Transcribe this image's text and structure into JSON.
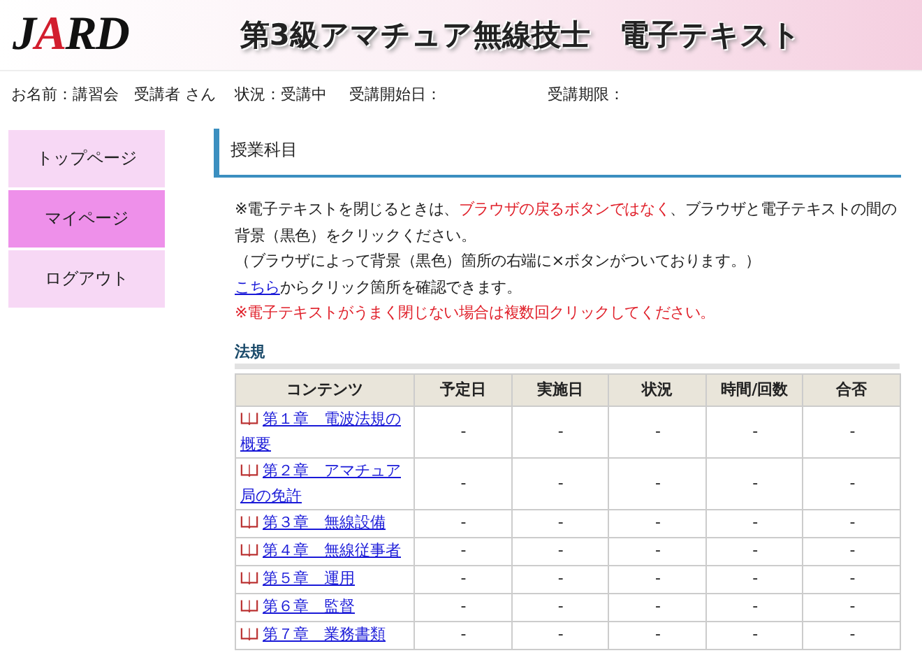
{
  "header": {
    "logo": [
      {
        "text": "J",
        "accent": false
      },
      {
        "text": "A",
        "accent": true
      },
      {
        "text": "RD",
        "accent": false
      }
    ],
    "title": "第3級アマチュア無線技士　電子テキスト"
  },
  "user_info": [
    "お名前：講習会　受講者 さん",
    "状況：受講中",
    "受講開始日：",
    "受講期限："
  ],
  "sidebar": {
    "items": [
      {
        "label": "トップページ",
        "selected": false
      },
      {
        "label": "マイページ",
        "selected": true
      },
      {
        "label": "ログアウト",
        "selected": false
      }
    ]
  },
  "section_title": "授業科目",
  "notes": [
    {
      "parts": [
        {
          "kind": "text",
          "text": "※電子テキストを閉じるときは、"
        },
        {
          "kind": "red",
          "text": "ブラウザの戻るボタンではなく"
        },
        {
          "kind": "text",
          "text": "、ブラウザと電子テキストの間の背景（黒色）をクリックください。"
        }
      ]
    },
    {
      "parts": [
        {
          "kind": "text",
          "text": "（ブラウザによって背景（黒色）箇所の右端に×ボタンがついております。）"
        }
      ]
    },
    {
      "parts": [
        {
          "kind": "link",
          "text": "こちら"
        },
        {
          "kind": "text",
          "text": "からクリック箇所を確認できます。"
        }
      ]
    },
    {
      "parts": [
        {
          "kind": "red",
          "text": "※電子テキストがうまく閉じない場合は複数回クリックしてください。"
        }
      ]
    }
  ],
  "subject": "法規",
  "table": {
    "columns": [
      "コンテンツ",
      "予定日",
      "実施日",
      "状況",
      "時間/回数",
      "合否"
    ],
    "rows": [
      {
        "cells": [
          "第１章　電波法規の概要",
          "-",
          "-",
          "-",
          "-",
          "-"
        ]
      },
      {
        "cells": [
          "第２章　アマチュア局の免許",
          "-",
          "-",
          "-",
          "-",
          "-"
        ]
      },
      {
        "cells": [
          "第３章　無線設備",
          "-",
          "-",
          "-",
          "-",
          "-"
        ]
      },
      {
        "cells": [
          "第４章　無線従事者",
          "-",
          "-",
          "-",
          "-",
          "-"
        ]
      },
      {
        "cells": [
          "第５章　運用",
          "-",
          "-",
          "-",
          "-",
          "-"
        ]
      },
      {
        "cells": [
          "第６章　監督",
          "-",
          "-",
          "-",
          "-",
          "-"
        ]
      },
      {
        "cells": [
          "第７章　業務書類",
          "-",
          "-",
          "-",
          "-",
          "-"
        ]
      }
    ]
  }
}
